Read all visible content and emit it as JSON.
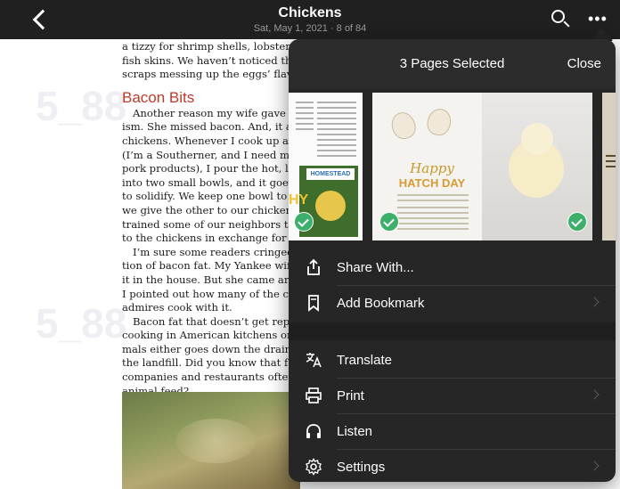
{
  "topbar": {
    "title": "Chickens",
    "subtitle": "Sat, May 1, 2021 · 8 of 84"
  },
  "article": {
    "lines_intro": [
      "a tizzy for shrimp shells, lobster sh",
      "fish skins. We haven’t noticed thos",
      "scraps messing up the eggs’ flavors"
    ],
    "heading": "Bacon Bits",
    "para1": [
      "Another reason my wife gave up t",
      "ism. She missed bacon. And, it appe",
      "chickens. Whenever I cook up a mes",
      "(I’m a Southerner, and I need my da",
      "pork products), I pour the hot, liquid",
      "into two small bowls, and it goes int",
      "to solidify. We keep one bowl to cook",
      "we give the other to our chickens. W",
      "trained some of our neighbors to bri",
      "to the chickens in exchange for a fev"
    ],
    "para2": [
      "I’m sure some readers cringed a",
      "tion of bacon fat. My Yankee wife d",
      "it in the house. But she came aroun",
      "I pointed out how many of the cher",
      "admires cook with it."
    ],
    "para3": [
      "Bacon fat that doesn’t get repurp",
      "cooking in American kitchens or fe",
      "mals either goes down the drain or",
      "the landfill. Did you know that fat f",
      "companies and restaurants often g",
      "animal feed?"
    ],
    "watermark": "5_88"
  },
  "popup": {
    "title": "3 Pages Selected",
    "close_label": "Close",
    "thumb_left_badge": "HOMESTEAD",
    "thumb_left_letters": "HY",
    "thumb_center_line1": "Happy",
    "thumb_center_line2": "HATCH DAY",
    "menu": [
      {
        "label": "Share With...",
        "icon": "share-icon",
        "chevron": false
      },
      {
        "label": "Add Bookmark",
        "icon": "bookmark-icon",
        "chevron": true
      },
      {
        "label": "Translate",
        "icon": "translate-icon",
        "chevron": false
      },
      {
        "label": "Print",
        "icon": "print-icon",
        "chevron": true
      },
      {
        "label": "Listen",
        "icon": "headphones-icon",
        "chevron": false
      },
      {
        "label": "Settings",
        "icon": "gear-icon",
        "chevron": true
      }
    ]
  },
  "colors": {
    "topbar": "#202020",
    "popup": "#262626",
    "heading": "#c0392b",
    "check": "#3cb06b"
  }
}
